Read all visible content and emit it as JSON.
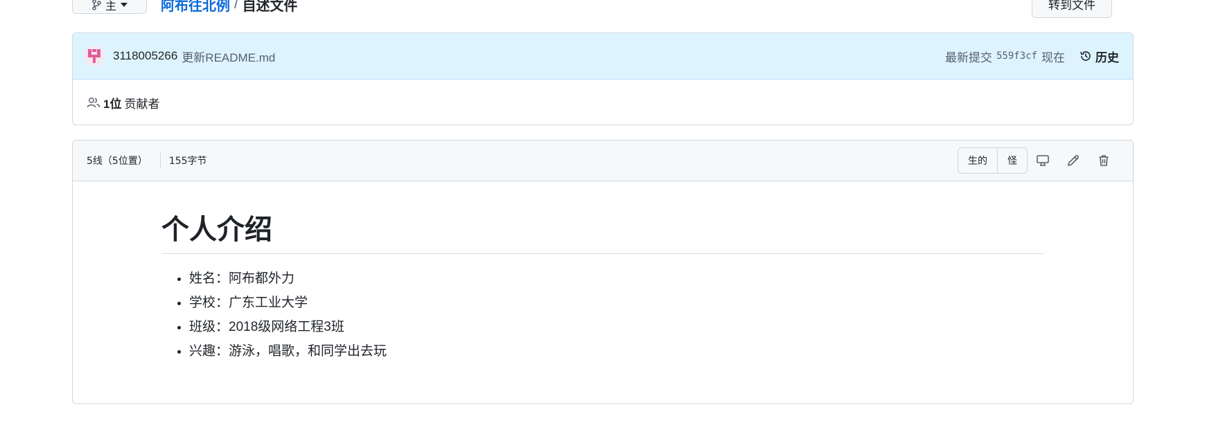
{
  "topbar": {
    "branch_label": "主",
    "repo_link": "阿布往北例",
    "separator": "/",
    "file_name": "自述文件",
    "goto_file_label": "转到文件"
  },
  "commit": {
    "author": "3118005266",
    "message": "更新README.md",
    "latest_label": "最新提交",
    "sha": "559f3cf",
    "time": "现在",
    "history_label": "历史"
  },
  "contributors": {
    "count_label": "1位",
    "suffix": "贡献者"
  },
  "file_header": {
    "lines_info": "5线（5位置）",
    "size_info": "155字节",
    "raw_label": "生的",
    "blame_label": "怪"
  },
  "readme": {
    "title": "个人介绍",
    "items": [
      "姓名：阿布都外力",
      "学校：广东工业大学",
      "班级：2018级网络工程3班",
      "兴趣：游泳，唱歌，和同学出去玩"
    ]
  },
  "colors": {
    "link": "#0969da",
    "commit_bg": "#ddf4ff",
    "border": "#d0d7de",
    "header_bg": "#f6f8fa",
    "avatar": "#e05d9c"
  }
}
